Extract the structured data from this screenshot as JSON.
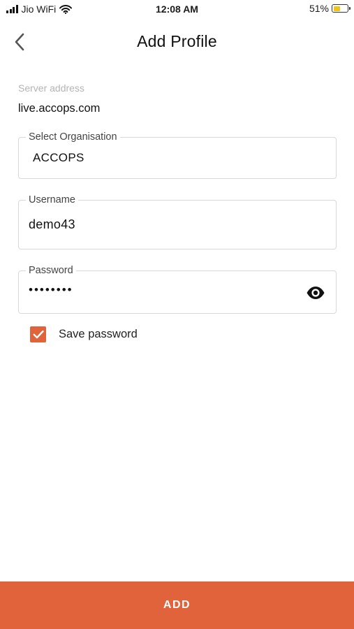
{
  "status_bar": {
    "carrier": "Jio WiFi",
    "time": "12:08 AM",
    "battery_percent": "51%",
    "battery_level": 0.51,
    "icons": [
      "signal-icon",
      "wifi-icon",
      "battery-icon"
    ]
  },
  "nav": {
    "title": "Add Profile",
    "back_icon": "chevron-left-icon"
  },
  "server": {
    "label": "Server address",
    "value": "live.accops.com"
  },
  "organisation": {
    "label": "Select Organisation",
    "value": "ACCOPS"
  },
  "username": {
    "label": "Username",
    "value": "demo43"
  },
  "password": {
    "label": "Password",
    "value": "••••••••",
    "toggle_icon": "eye-icon"
  },
  "save_password": {
    "label": "Save password",
    "checked": true
  },
  "add_button": {
    "label": "ADD"
  },
  "colors": {
    "accent": "#e0633c",
    "battery": "#f2c218"
  }
}
